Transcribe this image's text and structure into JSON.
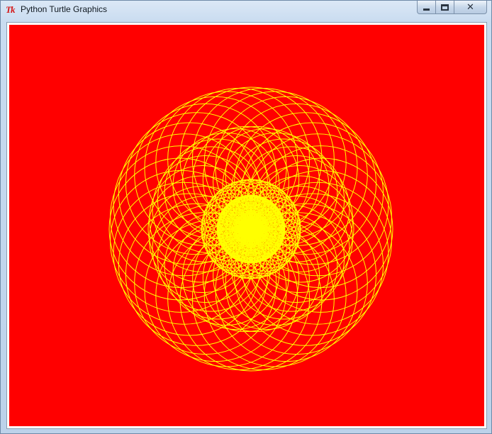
{
  "window": {
    "title": "Python Turtle Graphics",
    "icon_text": "Tk",
    "icon": "tk-feather-icon",
    "controls": [
      "minimize-icon",
      "maximize-icon",
      "close-icon"
    ]
  },
  "canvas": {
    "background_color": "#ff0000",
    "pen_color": "#ffff00",
    "pattern": "spirograph circles"
  }
}
